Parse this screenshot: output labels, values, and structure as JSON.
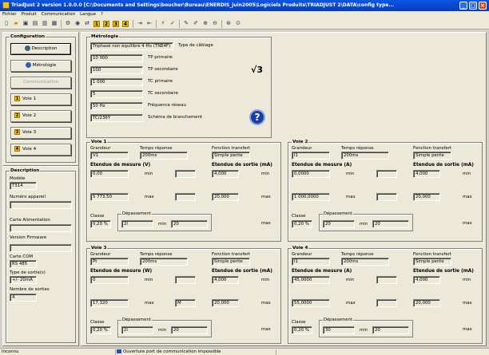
{
  "window": {
    "title": "TriadJust 2       version 1.0.0.0    [C:\\Documents and Settings\\boucher\\Bureau\\ENERDIS_juin2005\\Logiciels Produits\\TRIADJUST 2\\DATA\\config type...",
    "minimize": "_",
    "maximize": "□",
    "close": "×"
  },
  "menu": [
    "Fichier",
    "Produit",
    "Communication",
    "Langue",
    "?"
  ],
  "toolbar": {
    "nums": [
      "1",
      "2",
      "3",
      "4"
    ]
  },
  "config": {
    "title": "Configuration",
    "buttons": [
      "Description",
      "Métrologie",
      "Communication",
      "Voie 1",
      "Voie 2",
      "Voie 3",
      "Voie 4"
    ],
    "voie_nums": [
      "1",
      "2",
      "3",
      "4"
    ]
  },
  "description": {
    "title": "Description",
    "modele_label": "Modèle",
    "modele_value": "T314",
    "numero_label": "Numéro appareil",
    "numero_value": "",
    "carte_alim_label": "Carte Alimentation",
    "carte_alim_value": "",
    "version_label": "Version Firmware",
    "version_value": "",
    "carte_com_label": "Carte COM",
    "carte_com_value": "RS 485",
    "type_sortie_label": "Type de sortie(s)",
    "type_sortie_value": "+/- 20mA",
    "nombre_label": "Nombre de sorties",
    "nombre_value": "4"
  },
  "metrologie": {
    "title": "Métrologie",
    "cablage_value": "Triphasé non équilibré 4 fils (TNE4F)",
    "cablage_label": "Type de câblage",
    "tp_prim_value": "10 000",
    "tp_prim_label": "TP primaire",
    "tp_sec_value": "100",
    "tp_sec_label": "TP secondaire",
    "tc_prim_value": "1 000",
    "tc_prim_label": "TC primaire",
    "tc_sec_value": "5",
    "tc_sec_label": "TC secondaire",
    "freq_value": "50 Hz",
    "freq_label": "Fréquence réseau",
    "schema_value": "TC/236Y",
    "schema_label": "Schéma de branchement",
    "sqrt3": "√3",
    "help": "?"
  },
  "labels": {
    "grandeur": "Grandeur",
    "temps": "Temps réponse",
    "fonction": "Fonction transfert",
    "etendue_sortie": "Etendue de sortie (mA)",
    "classe": "Classe",
    "depassement": "Dépassement",
    "min": "min",
    "max": "max"
  },
  "voies": [
    {
      "title": "Voie 1",
      "grandeur": "V1",
      "temps": "200ms",
      "fonction": "Simple pente",
      "etendue_label": "Etendue de mesure (V)",
      "mes_min": "0,00",
      "mes_max": "5 773,50",
      "mes_max_unit": "max",
      "sortie_min": "4,000",
      "sortie_max": "20,000",
      "classe": "0,20 %",
      "dep_min": "2l",
      "dep_max": "20"
    },
    {
      "title": "Voie 2",
      "grandeur": "I1",
      "temps": "200ms",
      "fonction": "Simple pente",
      "etendue_label": "Etendue de mesure (A)",
      "mes_min": "0,0000",
      "mes_max": "1 000,0000",
      "mes_max_unit": "max",
      "sortie_min": "4,000",
      "sortie_max": "20,000",
      "classe": "0,20 %",
      "dep_min": "20",
      "dep_max": "20"
    },
    {
      "title": "Voie 3",
      "grandeur": "Pt",
      "temps": "200ms",
      "fonction": "Simple pente",
      "etendue_label": "Etendue de mesure (W)",
      "mes_min": "0",
      "mes_max": "17,320",
      "mes_max_unit": "max",
      "mes_max_extra": "M",
      "sortie_min": "4,000",
      "sortie_max": "20,000",
      "classe": "0,20 %",
      "dep_min": "2l",
      "dep_max": "20"
    },
    {
      "title": "Voie 4",
      "grandeur": "I1",
      "temps": "200ms",
      "fonction": "Simple pente",
      "etendue_label": "Etendue de mesure (A)",
      "mes_min": "45,0000",
      "mes_max": "55,0000",
      "mes_max_unit": "max",
      "sortie_min": "4,000",
      "sortie_max": "20,000",
      "classe": "0,20 %",
      "dep_min": "30",
      "dep_max": "20"
    }
  ],
  "status": {
    "left": "Inconnu",
    "message": "Ouverture port de communication impossible"
  },
  "colors": {
    "titlebar": "#0846c8",
    "accent_yellow": "#f0c000",
    "background": "#ece9d8"
  }
}
